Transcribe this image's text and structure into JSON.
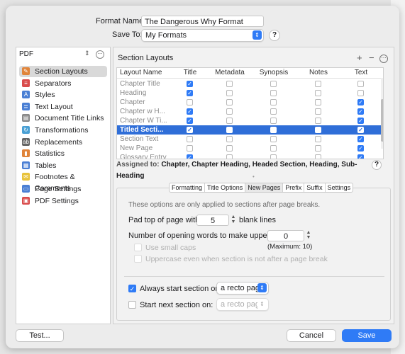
{
  "header": {
    "format_name_label": "Format Name:",
    "format_name_value": "The Dangerous Why Format",
    "save_to_label": "Save To:",
    "save_to_value": "My Formats",
    "help": "?"
  },
  "sidebar": {
    "filter_value": "PDF",
    "items": [
      {
        "label": "Section Layouts",
        "icon": "section-layouts-icon",
        "color": "#e0843a",
        "glyph": "✎"
      },
      {
        "label": "Separators",
        "icon": "separators-icon",
        "color": "#d94b4b",
        "glyph": "≡"
      },
      {
        "label": "Styles",
        "icon": "styles-icon",
        "color": "#4a7fd4",
        "glyph": "A"
      },
      {
        "label": "Text Layout",
        "icon": "text-layout-icon",
        "color": "#4a7fd4",
        "glyph": "≣"
      },
      {
        "label": "Document Title Links",
        "icon": "document-title-links-icon",
        "color": "#888888",
        "glyph": "▤"
      },
      {
        "label": "Transformations",
        "icon": "transformations-icon",
        "color": "#4aa0d4",
        "glyph": "↻"
      },
      {
        "label": "Replacements",
        "icon": "replacements-icon",
        "color": "#666666",
        "glyph": "ab"
      },
      {
        "label": "Statistics",
        "icon": "statistics-icon",
        "color": "#e0843a",
        "glyph": "▮"
      },
      {
        "label": "Tables",
        "icon": "tables-icon",
        "color": "#4a7fd4",
        "glyph": "▦"
      },
      {
        "label": "Footnotes & Comments",
        "icon": "footnotes-comments-icon",
        "color": "#e8c23a",
        "glyph": "✉"
      },
      {
        "label": "Page Settings",
        "icon": "page-settings-icon",
        "color": "#4a7fd4",
        "glyph": "▭"
      },
      {
        "label": "PDF Settings",
        "icon": "pdf-settings-icon",
        "color": "#d94b4b",
        "glyph": "▣"
      }
    ]
  },
  "panel": {
    "title": "Section Layouts",
    "columns": [
      "Layout Name",
      "Title",
      "Metadata",
      "Synopsis",
      "Notes",
      "Text"
    ],
    "rows": [
      {
        "name": "Chapter Title",
        "checks": [
          true,
          false,
          false,
          false,
          false
        ]
      },
      {
        "name": "Heading",
        "checks": [
          true,
          false,
          false,
          false,
          false
        ]
      },
      {
        "name": "Chapter",
        "checks": [
          false,
          false,
          false,
          false,
          true
        ]
      },
      {
        "name": "Chapter w H...",
        "checks": [
          true,
          false,
          false,
          false,
          true
        ]
      },
      {
        "name": "Chapter W Ti...",
        "checks": [
          true,
          false,
          false,
          false,
          true
        ]
      },
      {
        "name": "Titled Secti...",
        "checks": [
          true,
          false,
          false,
          false,
          true
        ],
        "selected": true
      },
      {
        "name": "Section Text",
        "checks": [
          false,
          false,
          false,
          false,
          true
        ]
      },
      {
        "name": "New Page",
        "checks": [
          false,
          false,
          false,
          false,
          true
        ]
      },
      {
        "name": "Glossary Entry",
        "checks": [
          true,
          false,
          false,
          false,
          true
        ]
      }
    ],
    "assigned_label": "Assigned to:",
    "assigned_value": "Chapter, Chapter Heading, Headed Section, Heading, Sub-Heading",
    "tabs": [
      "Formatting",
      "Title Options",
      "New Pages",
      "Prefix",
      "Suffix",
      "Settings"
    ],
    "active_tab": "New Pages",
    "note": "These options are only applied to sections after page breaks.",
    "pad_label": "Pad top of page with:",
    "pad_value": "5",
    "pad_suffix": "blank lines",
    "opening_label": "Number of opening words to make uppercase:",
    "opening_value": "0",
    "maximum": "(Maximum: 10)",
    "small_caps": "Use small caps",
    "uppercase_even": "Uppercase even when section is not after a page break",
    "always_start_label": "Always start section on:",
    "always_start_value": "a recto page",
    "start_next_label": "Start next section on:",
    "start_next_value": "a recto page"
  },
  "footer": {
    "test_label": "Test...",
    "cancel_label": "Cancel",
    "save_label": "Save"
  }
}
